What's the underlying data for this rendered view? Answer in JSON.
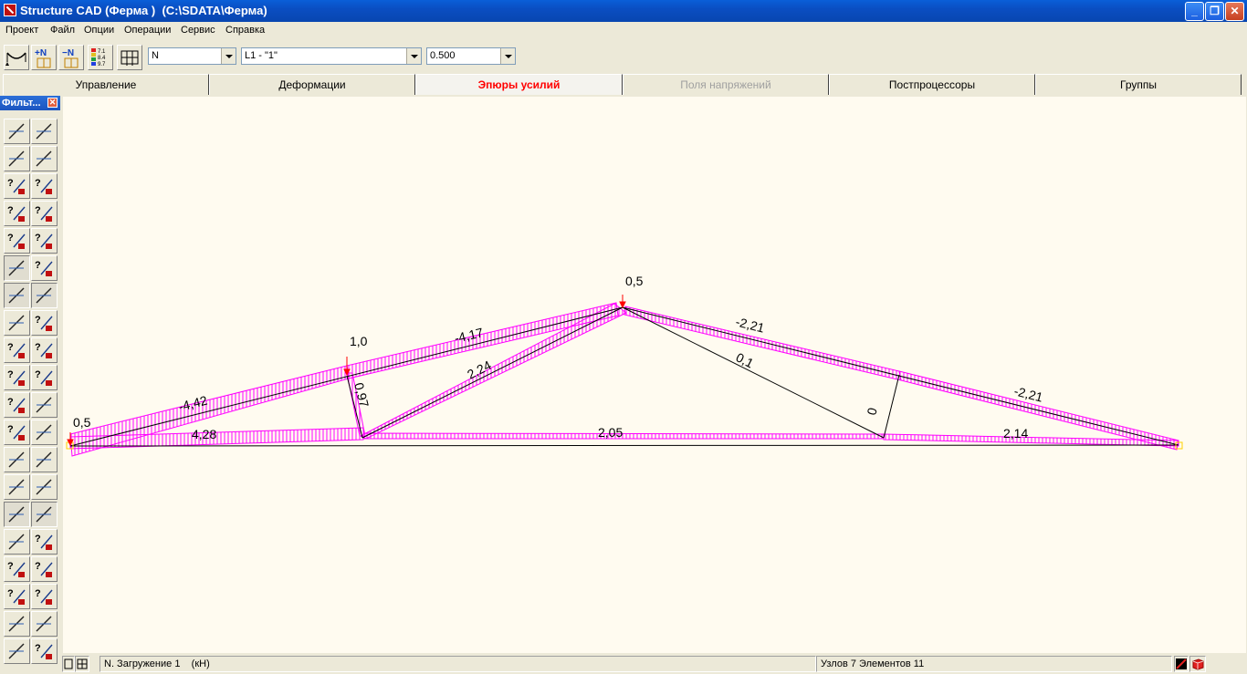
{
  "window": {
    "title": "Structure CAD (Ферма )  (C:\\SDATA\\Ферма)",
    "minimize": "_",
    "restore": "❐",
    "close": "✕"
  },
  "menu": [
    "Проект",
    "Файл",
    "Опции",
    "Операции",
    "Сервис",
    "Справка"
  ],
  "toolbar": {
    "icon_names": [
      "beam-deform-icon",
      "add-force-icon",
      "remove-force-icon",
      "scale-values-icon",
      "frame-icon"
    ],
    "scale_labels": [
      "7.1",
      "8.4",
      "9.7"
    ],
    "force_select": "N",
    "load_select": "L1 - \"1\"",
    "scale_select": "0.500"
  },
  "tabs": [
    {
      "label": "Управление",
      "state": "normal"
    },
    {
      "label": "Деформации",
      "state": "normal"
    },
    {
      "label": "Эпюры усилий",
      "state": "active"
    },
    {
      "label": "Поля напряжений",
      "state": "disabled"
    },
    {
      "label": "Постпроцессоры",
      "state": "normal"
    },
    {
      "label": "Группы",
      "state": "normal"
    }
  ],
  "panel": {
    "title": "Фильт...",
    "close": "✕",
    "tool_icons": [
      "pencil-icon",
      "eraser-icon",
      "cube-icon",
      "spring-icon",
      "query-bar-icon",
      "query-node-icon",
      "query-ne-icon",
      "query-nj-icon",
      "query-te-icon",
      "query-r-icon",
      "support-icon",
      "query-grid-icon",
      "cross-icon",
      "cross-blue-icon",
      "hatch-icon",
      "query-arrow-icon",
      "query-load-icon",
      "query-down-icon",
      "query-lf-icon",
      "query-twin-icon",
      "query-m-icon",
      "axes-icon",
      "query-dots-icon",
      "grid-move-icon",
      "grid-table-icon",
      "grid-lines-icon",
      "ruler-icon",
      "dimension-icon",
      "layer-green-icon",
      "brush-icon",
      "layers-icon",
      "query-plus-icon",
      "query-n-icon",
      "query-g-icon",
      "query-g2-icon",
      "query-l-icon",
      "table-icon",
      "table-red-icon",
      "shape-icon",
      "query-gl-icon"
    ],
    "tool_pressed": [
      false,
      false,
      false,
      false,
      false,
      false,
      false,
      false,
      false,
      false,
      true,
      false,
      true,
      true,
      false,
      false,
      false,
      false,
      false,
      false,
      false,
      false,
      false,
      false,
      false,
      false,
      false,
      false,
      true,
      true,
      false,
      false,
      false,
      false,
      false,
      false,
      false,
      false,
      false,
      false
    ]
  },
  "diagram": {
    "highlight_color": "#ff00ff",
    "load_color": "#ff0000",
    "labels": {
      "load_left": "0,5",
      "load_mid": "1,0",
      "load_top": "0,5",
      "top_left_outer": "-4,42",
      "top_left_inner": "-4,17",
      "top_right_inner": "-2,21",
      "top_right_outer": "-2,21",
      "bottom_left": "4,28",
      "bottom_mid": "2,05",
      "bottom_right": "2,14",
      "vertical_left": "0,97",
      "diagonal_left": "2,24",
      "diagonal_right": "0,1",
      "vertical_right": "0"
    }
  },
  "status": {
    "view_icons": [
      "view-single-icon",
      "view-split-icon"
    ],
    "load_case": "N. Загружение 1    (кН)",
    "model_info": "Узлов 7 Элементов 11",
    "status_icons": [
      "model-icon",
      "cube-red-icon"
    ]
  }
}
